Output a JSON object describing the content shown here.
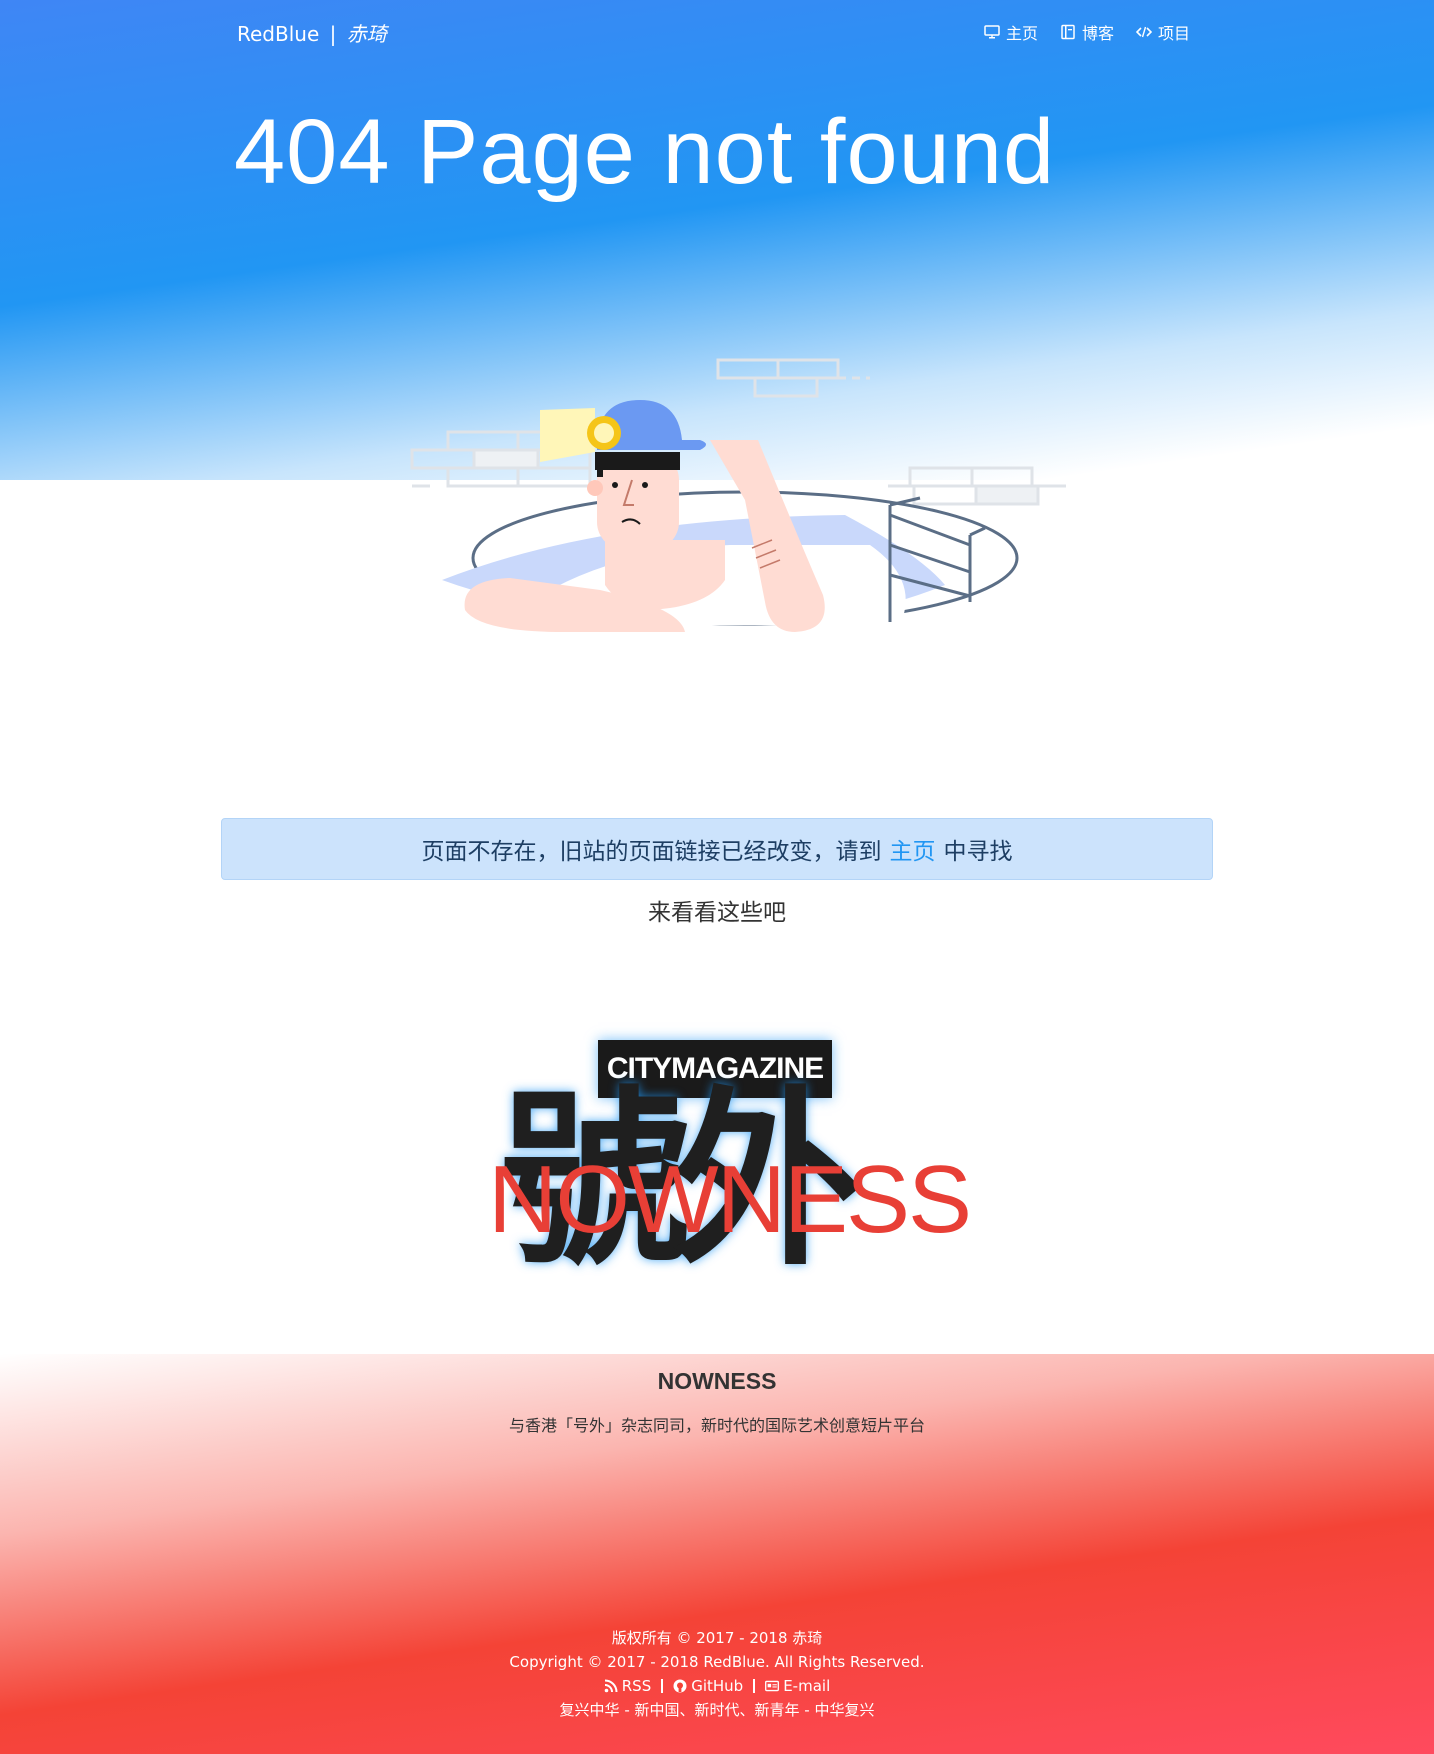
{
  "nav": {
    "brand": "RedBlue",
    "brand_separator": "|",
    "brand_script": "赤琦",
    "items": [
      {
        "label": "主页",
        "icon": "monitor-icon"
      },
      {
        "label": "博客",
        "icon": "book-icon"
      },
      {
        "label": "项目",
        "icon": "code-icon"
      }
    ]
  },
  "hero": {
    "title": "404 Page not found"
  },
  "alert": {
    "before": "页面不存在，旧站的页面链接已经改变，请到",
    "link": "主页",
    "after": "中寻找"
  },
  "suggest": {
    "heading": "来看看这些吧"
  },
  "card": {
    "logo_badge": "CITYMAGAZINE",
    "logo_big": "號外",
    "logo_overlay": "NOWNESS",
    "title": "NOWNESS",
    "description": "与香港「号外」杂志同司，新时代的国际艺术创意短片平台"
  },
  "footer": {
    "line1": "版权所有 © 2017 - 2018 赤琦",
    "line2": "Copyright © 2017 - 2018 RedBlue. All Rights Reserved.",
    "links": [
      {
        "label": "RSS",
        "icon": "rss-icon"
      },
      {
        "label": "GitHub",
        "icon": "github-icon"
      },
      {
        "label": "E-mail",
        "icon": "id-card-icon"
      }
    ],
    "line3": "复兴中华 - 新中国、新时代、新青年 - 中华复兴"
  },
  "colors": {
    "blue": "#2196f3",
    "red": "#f44336",
    "alert_bg": "#cce3fc"
  }
}
